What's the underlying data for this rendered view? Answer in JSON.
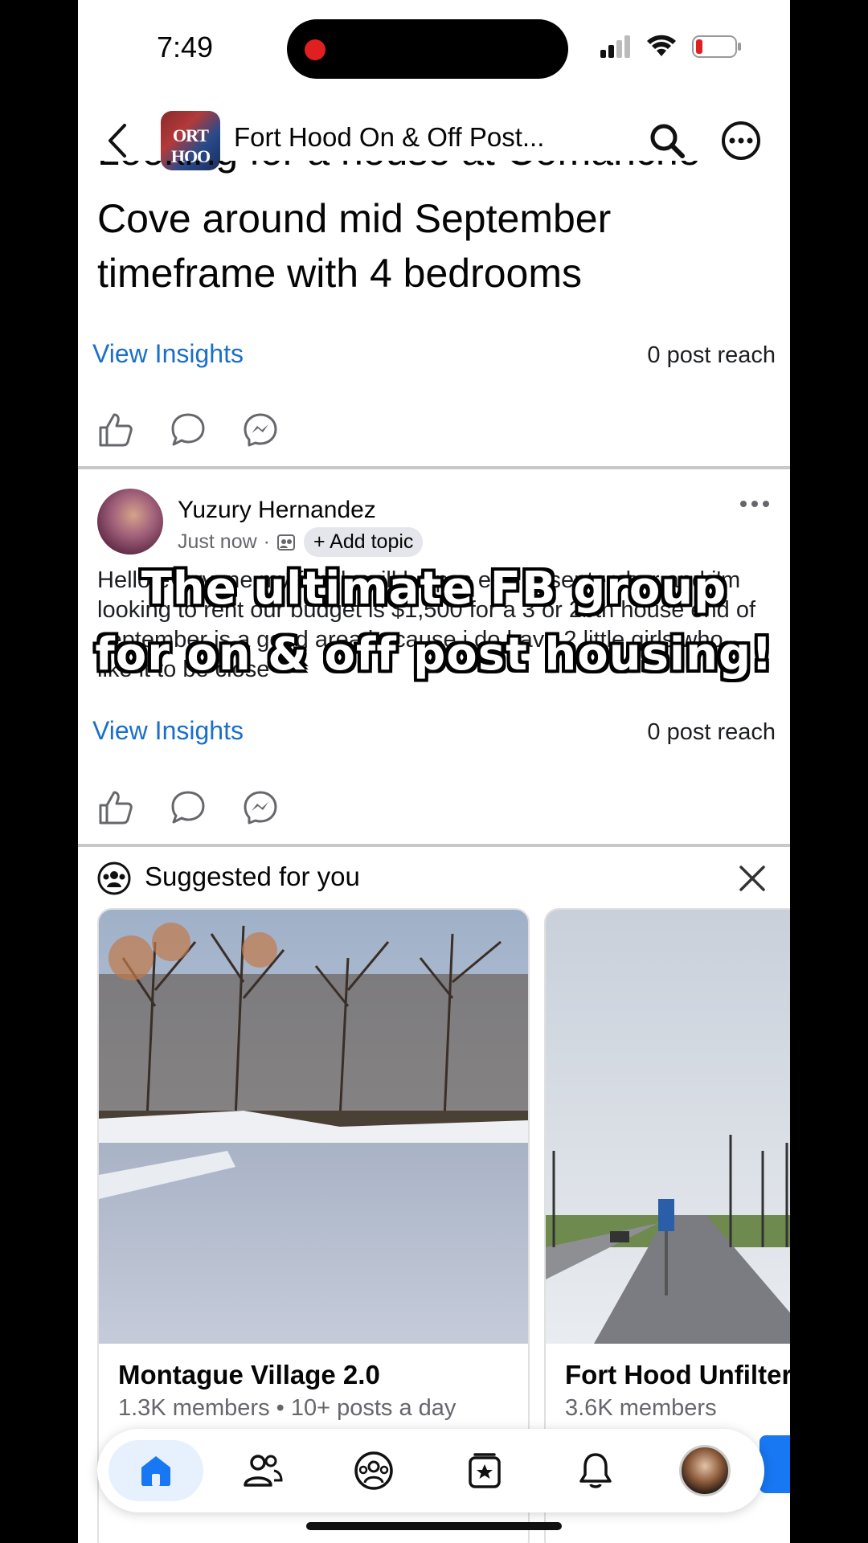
{
  "status": {
    "time": "7:49"
  },
  "header": {
    "title": "Fort Hood On & Off Post...",
    "avatar_text": "ORT HOO"
  },
  "post1": {
    "text_partial_top": "Looking for a house at Comanche Village",
    "text": "Cove around mid September timeframe with 4 bedrooms",
    "insights_label": "View Insights",
    "reach": "0 post reach"
  },
  "post2": {
    "author": "Yuzury Hernandez",
    "time": "Just now",
    "topic_chip": "+ Add topic",
    "text": "Hello everyone my family will be pcs end of september and i'm looking to rent our budget is $1,500 for a 3 or 2bth house end of september is a good area because i do have 2 little girls who like it to be close",
    "insights_label": "View Insights",
    "reach": "0 post reach"
  },
  "overlay": {
    "line1": "The ultimate FB group",
    "line2": "for on & off post housing!"
  },
  "suggested": {
    "title": "Suggested for you",
    "cards": [
      {
        "name": "Montague Village 2.0",
        "meta": "1.3K members • 10+ posts a day"
      },
      {
        "name": "Fort Hood Unfiltered",
        "meta": "3.6K members"
      }
    ]
  },
  "nav": {
    "items": [
      "home-icon",
      "friends-icon",
      "groups-icon",
      "feeds-icon",
      "notifications-icon",
      "profile-avatar"
    ]
  },
  "colors": {
    "accent": "#1877f2",
    "link": "#1b6fc8"
  }
}
